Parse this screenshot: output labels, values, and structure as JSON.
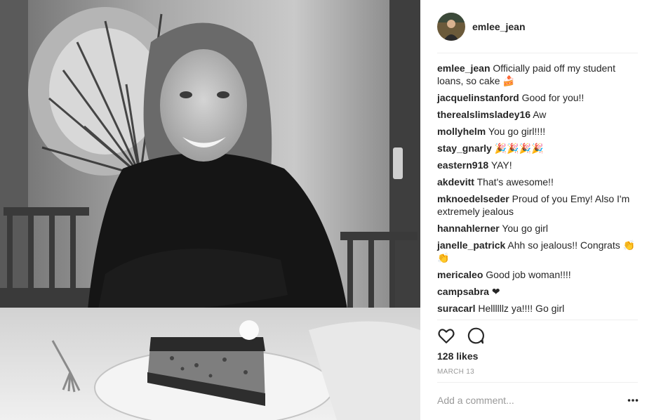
{
  "post": {
    "username": "emlee_jean",
    "likes": "128 likes",
    "date": "MARCH 13",
    "add_comment_placeholder": "Add a comment..."
  },
  "comments": [
    {
      "user": "emlee_jean",
      "text": "Officially paid off my student loans, so cake 🍰"
    },
    {
      "user": "jacquelinstanford",
      "text": "Good for you!!"
    },
    {
      "user": "therealslimsladey16",
      "text": "Aw"
    },
    {
      "user": "mollyhelm",
      "text": "You go girl!!!!"
    },
    {
      "user": "stay_gnarly",
      "text": "🎉🎉🎉🎉"
    },
    {
      "user": "eastern918",
      "text": "YAY!"
    },
    {
      "user": "akdevitt",
      "text": "That's awesome!!"
    },
    {
      "user": "mknoedelseder",
      "text": "Proud of you Emy! Also I'm extremely jealous"
    },
    {
      "user": "hannahlerner",
      "text": "You go girl"
    },
    {
      "user": "janelle_patrick",
      "text": "Ahh so jealous!! Congrats 👏👏"
    },
    {
      "user": "mericaleo",
      "text": "Good job woman!!!!"
    },
    {
      "user": "campsabra",
      "text": "❤"
    },
    {
      "user": "suracarl",
      "text": "Hellllllz ya!!!! Go girl"
    }
  ],
  "icons": {
    "like": "heart-icon",
    "comment": "comment-bubble-icon",
    "more": "more-options-icon"
  },
  "colors": {
    "text": "#262626",
    "muted": "#999999",
    "divider": "#efefef"
  }
}
